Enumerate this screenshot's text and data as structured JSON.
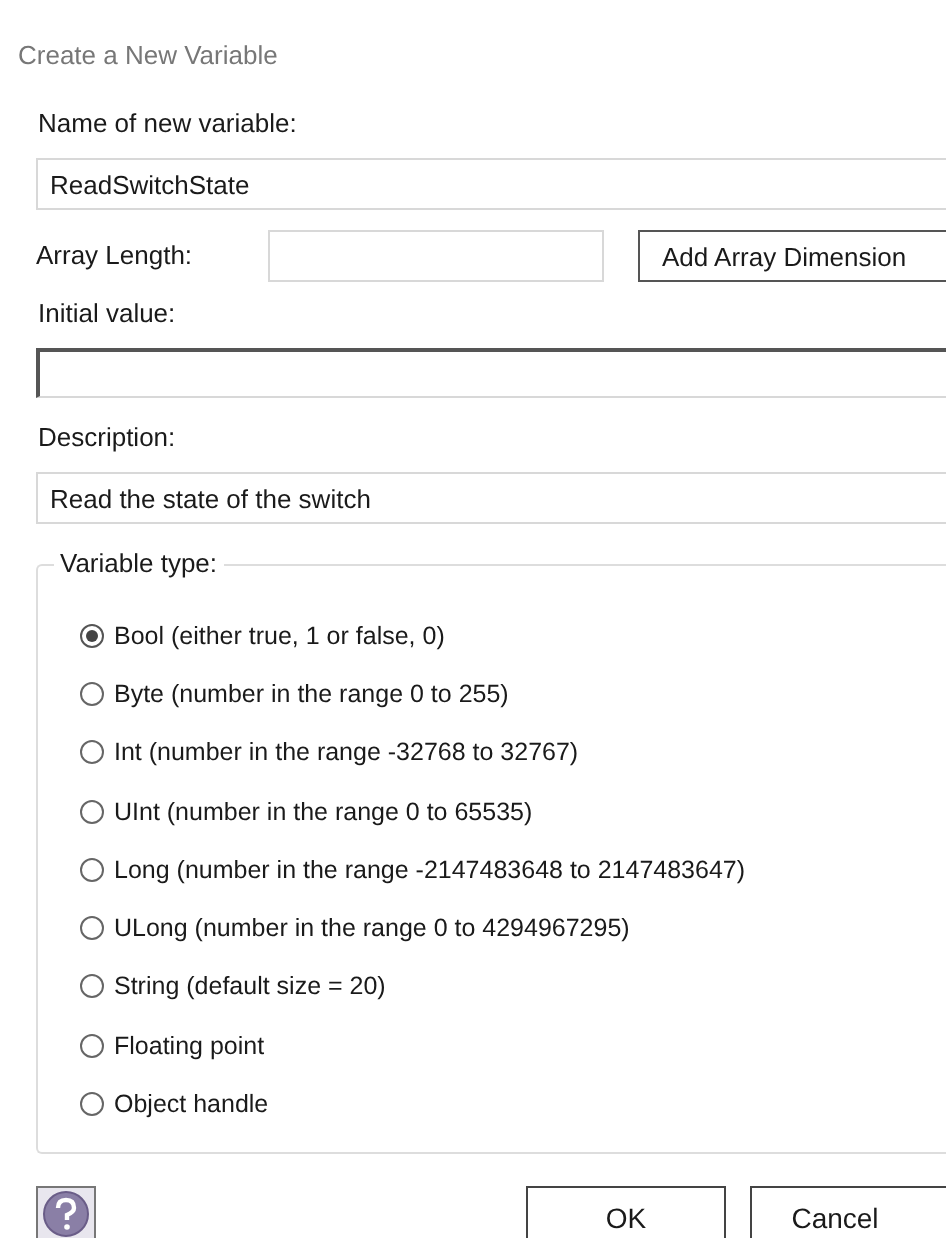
{
  "window": {
    "title": "Create a New Variable"
  },
  "name_field": {
    "label": "Name of new variable:",
    "value": "ReadSwitchState"
  },
  "array_length": {
    "label": "Array Length:",
    "button": "Add Array Dimension"
  },
  "initial_value": {
    "label": "Initial value:"
  },
  "description": {
    "label": "Description:",
    "value": "Read the state of the switch"
  },
  "variable_type": {
    "legend": "Variable type:",
    "options": [
      {
        "label": "Bool (either true, 1 or false, 0)",
        "selected": true
      },
      {
        "label": "Byte (number in the range 0 to 255)",
        "selected": false
      },
      {
        "label": "Int (number in the range -32768 to 32767)",
        "selected": false
      },
      {
        "label": "UInt (number in the range 0 to 65535)",
        "selected": false
      },
      {
        "label": "Long (number in the range -2147483648 to 2147483647)",
        "selected": false
      },
      {
        "label": "ULong (number in the range 0 to 4294967295)",
        "selected": false
      },
      {
        "label": "String (default size = 20)",
        "selected": false
      },
      {
        "label": "Floating point",
        "selected": false
      },
      {
        "label": "Object handle",
        "selected": false
      }
    ]
  },
  "buttons": [
    "OK",
    "Cancel"
  ]
}
